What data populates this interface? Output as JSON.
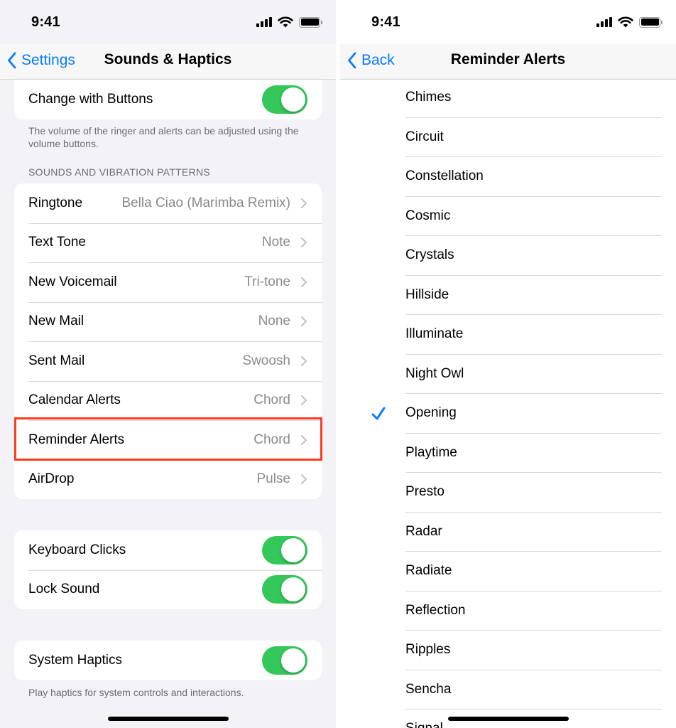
{
  "left": {
    "status": {
      "time": "9:41"
    },
    "nav": {
      "back_label": "Settings",
      "title": "Sounds & Haptics"
    },
    "change_with_buttons": {
      "label": "Change with Buttons",
      "on": true
    },
    "volume_footnote": "The volume of the ringer and alerts can be adjusted using the volume buttons.",
    "section_header": "SOUNDS AND VIBRATION PATTERNS",
    "sound_rows": [
      {
        "label": "Ringtone",
        "value": "Bella Ciao (Marimba Remix)"
      },
      {
        "label": "Text Tone",
        "value": "Note"
      },
      {
        "label": "New Voicemail",
        "value": "Tri-tone"
      },
      {
        "label": "New Mail",
        "value": "None"
      },
      {
        "label": "Sent Mail",
        "value": "Swoosh"
      },
      {
        "label": "Calendar Alerts",
        "value": "Chord"
      },
      {
        "label": "Reminder Alerts",
        "value": "Chord"
      },
      {
        "label": "AirDrop",
        "value": "Pulse"
      }
    ],
    "keyboard_clicks": {
      "label": "Keyboard Clicks",
      "on": true
    },
    "lock_sound": {
      "label": "Lock Sound",
      "on": true
    },
    "system_haptics": {
      "label": "System Haptics",
      "on": true
    },
    "haptics_footnote": "Play haptics for system controls and interactions.",
    "highlight_color": "#ff3b1f"
  },
  "right": {
    "status": {
      "time": "9:41"
    },
    "nav": {
      "back_label": "Back",
      "title": "Reminder Alerts"
    },
    "tones": [
      "Chimes",
      "Circuit",
      "Constellation",
      "Cosmic",
      "Crystals",
      "Hillside",
      "Illuminate",
      "Night Owl",
      "Opening",
      "Playtime",
      "Presto",
      "Radar",
      "Radiate",
      "Reflection",
      "Ripples",
      "Sencha",
      "Signal"
    ],
    "selected_tone": "Opening"
  },
  "colors": {
    "accent": "#0a7aff",
    "toggle_on": "#34c759"
  },
  "icons": [
    "signal-icon",
    "wifi-icon",
    "battery-icon",
    "chevron-left-icon",
    "chevron-right-icon",
    "checkmark-icon"
  ]
}
